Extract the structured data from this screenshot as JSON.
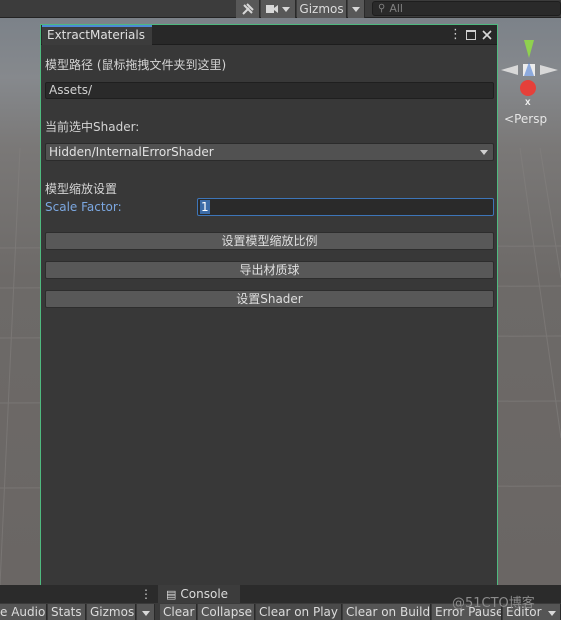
{
  "toolbar": {
    "gizmos_label": "Gizmos",
    "search_placeholder": "All"
  },
  "scene": {
    "persp_label": "Persp",
    "axis_x_label": "x"
  },
  "window": {
    "tab_title": "ExtractMaterials",
    "model_path_label": "模型路径 (鼠标拖拽文件夹到这里)",
    "model_path_value": "Assets/",
    "shader_label": "当前选中Shader:",
    "shader_value": "Hidden/InternalErrorShader",
    "scale_section_label": "模型缩放设置",
    "scale_factor_label": "Scale Factor:",
    "scale_factor_value": "1",
    "buttons": {
      "set_scale": "设置模型缩放比例",
      "export_materials": "导出材质球",
      "set_shader": "设置Shader"
    }
  },
  "bottom": {
    "console_tab": "Console",
    "game_buttons": [
      "e Audio",
      "Stats",
      "Gizmos"
    ],
    "console_buttons": [
      "Clear",
      "Collapse",
      "Clear on Play",
      "Clear on Build",
      "Error Pause",
      "Editor"
    ]
  },
  "watermark": "@51CTO博客",
  "colors": {
    "window_border": "#4fb97f",
    "tab_accent": "#4d8bd6",
    "scale_label": "#7ba7e0"
  }
}
